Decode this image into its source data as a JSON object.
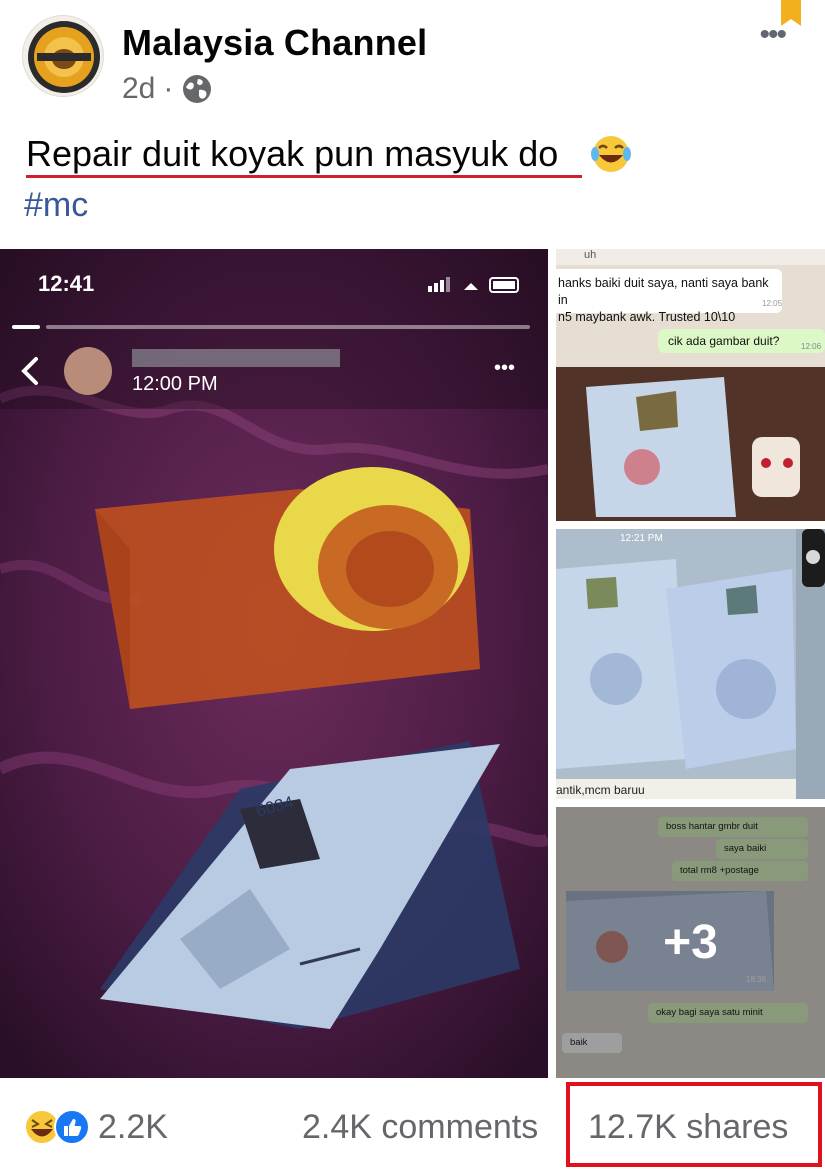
{
  "post": {
    "page_name": "Malaysia Channel",
    "time": "2d",
    "separator": "·",
    "audience_icon": "globe-icon",
    "caption": "Repair duit koyak pun masyuk do",
    "caption_emoji": "face-with-tears-of-joy-icon",
    "hashtag": "#mc"
  },
  "media": {
    "main_photo": {
      "status_time": "12:41",
      "story_time": "12:00 PM",
      "note_serial": "6034"
    },
    "thumb1": {
      "chat_name": "uh",
      "message_in": "hanks baiki duit saya, nanti saya bank in\nn5 maybank awk. Trusted 10\\10",
      "message_in_time": "12:05",
      "message_out": "cik ada gambar duit?",
      "message_out_time": "12:06"
    },
    "thumb2": {
      "status_time": "12:21 PM",
      "caption": "antik,mcm baruu"
    },
    "thumb3": {
      "msg1": "boss hantar gmbr duit",
      "msg2": "saya baiki",
      "msg3": "total rm8 +postage",
      "image_time": "18:36",
      "msg4": "okay bagi saya satu minit",
      "msg5": "baik"
    },
    "more_count": "+3"
  },
  "footer": {
    "reactions": [
      "haha-icon",
      "like-icon"
    ],
    "reaction_count": "2.2K",
    "comments": "2.4K comments",
    "shares": "12.7K shares"
  },
  "colors": {
    "link": "#385898",
    "highlight_box": "#e0101c",
    "caption_underline": "#d0202d",
    "secondary_text": "#65676b"
  }
}
